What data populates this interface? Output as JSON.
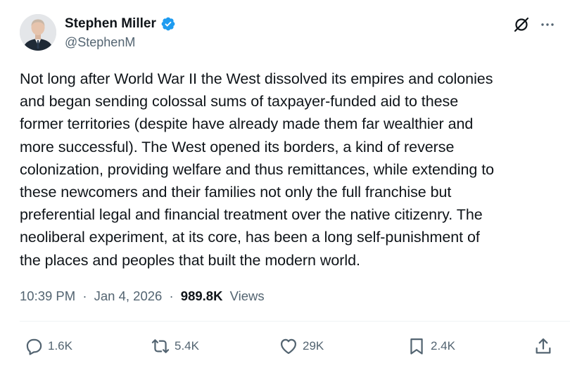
{
  "author": {
    "display_name": "Stephen Miller",
    "handle": "@StephenM",
    "verified": true
  },
  "tweet": {
    "text": "Not long after World War II the West dissolved its empires and colonies\nand began sending colossal sums of taxpayer-funded aid to these\nformer territories (despite have already made them far wealthier and\nmore successful). The West opened its borders, a kind of reverse\ncolonization, providing welfare and thus remittances, while extending to\nthese newcomers and their families not only the full franchise but\npreferential legal and financial treatment over the native citizenry. The\nneoliberal experiment, at its core, has been a long self-punishment of\nthe places and peoples that built the modern world.",
    "time": "10:39 PM",
    "date": "Jan 4, 2026",
    "separator": "·",
    "views_count": "989.8K",
    "views_label": "Views"
  },
  "actions": {
    "replies": "1.6K",
    "reposts": "5.4K",
    "likes": "29K",
    "bookmarks": "2.4K"
  },
  "icons": {
    "verified": "verified-badge-icon",
    "grok": "grok-icon",
    "more": "more-options-icon",
    "reply": "reply-icon",
    "repost": "repost-icon",
    "like": "heart-icon",
    "bookmark": "bookmark-icon",
    "share": "share-icon"
  },
  "colors": {
    "text_primary": "#0f1419",
    "text_secondary": "#536471",
    "verified_blue": "#1d9bf0",
    "divider": "#eff3f4"
  }
}
